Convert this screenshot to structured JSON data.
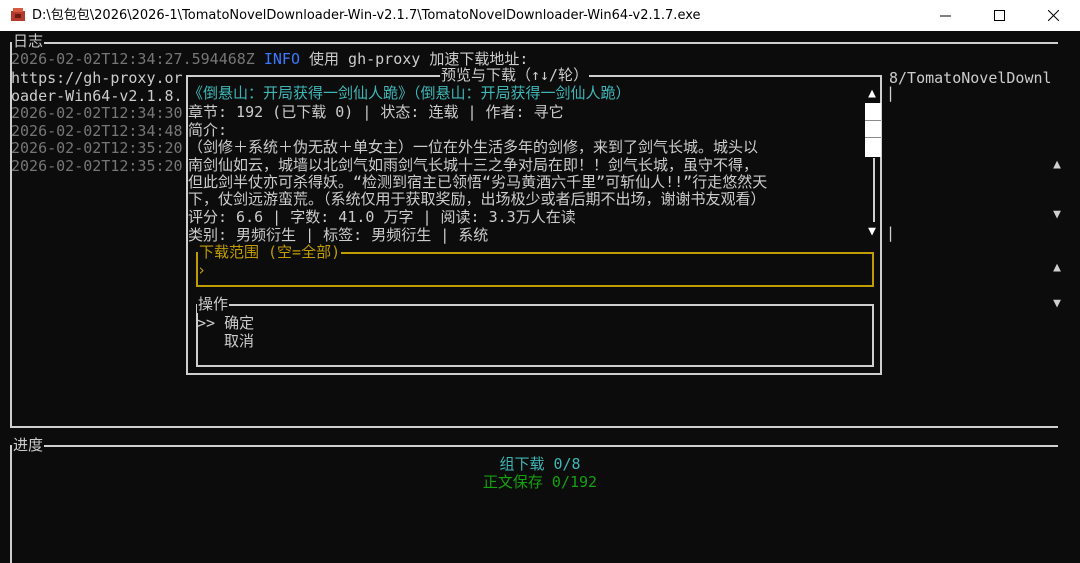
{
  "window": {
    "title": "D:\\包包包\\2026\\2026-1\\TomatoNovelDownloader-Win-v2.1.7\\TomatoNovelDownloader-Win64-v2.1.7.exe",
    "minimize_glyph": "—",
    "maximize_glyph": "☐",
    "close_glyph": "✕"
  },
  "log": {
    "label": "日志",
    "line1_time": "2026-02-02T12:34:27.594468Z",
    "line1_level": "INFO",
    "line1_msg": "使用 gh-proxy 加速下载地址:",
    "line2": "https://gh-proxy.or",
    "line2_tail": "8/TomatoNovelDownl",
    "line3": "oader-Win64-v2.1.8.",
    "times": [
      "2026-02-02T12:34:30",
      "2026-02-02T12:34:48",
      "2026-02-02T12:35:20",
      "2026-02-02T12:35:20"
    ]
  },
  "dialog": {
    "title": "预览与下载（↑↓/轮）",
    "book_title": "《倒悬山：开局获得一剑仙人跪》（倒悬山：开局获得一剑仙人跪）",
    "meta": "章节: 192 (已下载 0) | 状态: 连载 | 作者: 寻它",
    "intro_label": "简介:",
    "intro_lines": [
      "（剑修＋系统＋伪无敌＋单女主）一位在外生活多年的剑修，来到了剑气长城。城头以",
      "南剑仙如云，城墙以北剑气如雨剑气长城十三之争对局在即！！剑气长城，虽守不得，",
      "但此剑半仗亦可杀得妖。“检测到宿主已领悟“劣马黄酒六千里”可斩仙人!!”行走悠然天",
      "下，仗剑远游蛮荒。（系统仅用于获取奖励，出场极少或者后期不出场，谢谢书友观看）"
    ],
    "stats": "评分: 6.6 | 字数: 41.0 万字 | 阅读: 3.3万人在读",
    "tags": "类别: 男频衍生 | 标签: 男频衍生 | 系统",
    "range_label": "下载范围 (空=全部)",
    "range_value": "",
    "range_prompt": "›",
    "ops_label": "操作",
    "ops_cursor": ">>",
    "op_confirm": "确定",
    "op_cancel": "取消",
    "scroll_up": "▲",
    "scroll_down": "▼"
  },
  "progress": {
    "label": "进度",
    "group": "组下载 0/8",
    "text_save": "正文保存 0/192"
  },
  "colors": {
    "info": "#3b78ff",
    "cyan": "#3fb6b6",
    "green": "#13a10e",
    "gold": "#c19c00"
  }
}
